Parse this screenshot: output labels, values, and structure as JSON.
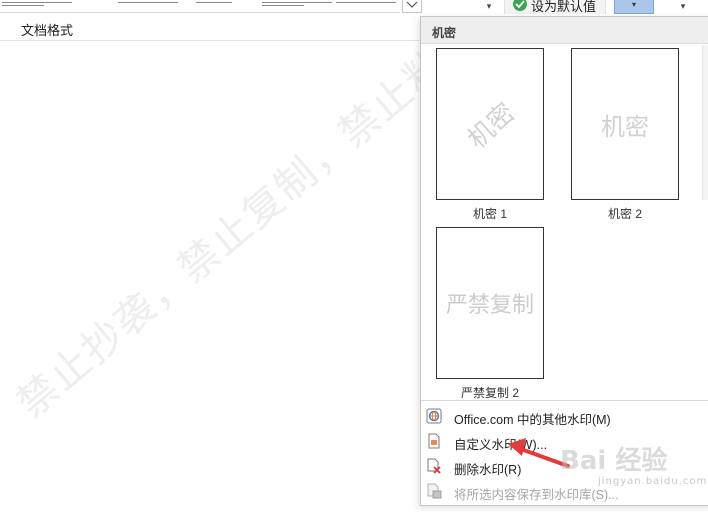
{
  "ribbon": {
    "set_default_label": "设为默认值",
    "dropdown_glyph": "▾"
  },
  "document": {
    "heading": "文档格式",
    "watermark_text": "禁止抄袭，禁止复制，禁止粘贴"
  },
  "watermark_panel": {
    "section_title": "机密",
    "items": [
      {
        "caption": "机密 1",
        "preview_text": "机密",
        "style": "diagonal"
      },
      {
        "caption": "机密 2",
        "preview_text": "机密",
        "style": "horizontal"
      },
      {
        "caption": "严禁复制 2",
        "preview_text": "严禁复制",
        "style": "horizontal"
      }
    ],
    "menu": [
      {
        "label": "Office.com 中的其他水印(M)",
        "icon": "office-globe-icon",
        "enabled": true
      },
      {
        "label": "自定义水印(W)...",
        "icon": "custom-watermark-icon",
        "enabled": true
      },
      {
        "label": "删除水印(R)",
        "icon": "remove-watermark-icon",
        "enabled": true
      },
      {
        "label": "将所选内容保存到水印库(S)...",
        "icon": "save-to-gallery-icon",
        "enabled": false
      }
    ]
  },
  "overlay": {
    "baidu_logo_text": "Bai 经验",
    "baidu_sub_text": "jingyan.baidu.com"
  },
  "colors": {
    "accent_blue": "#a9c7ea",
    "check_green": "#3aa655",
    "arrow_red": "#e23b3b"
  }
}
